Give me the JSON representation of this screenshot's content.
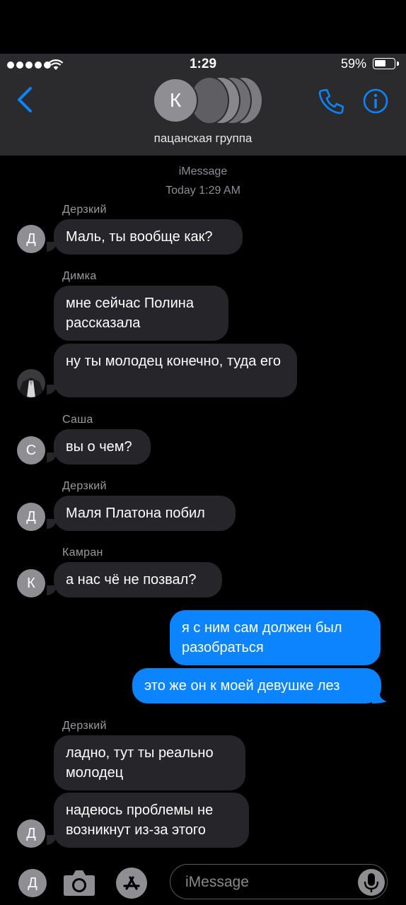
{
  "status_bar": {
    "time": "1:29",
    "battery": "59%",
    "battery_level": 0.59
  },
  "header": {
    "group_initial": "К",
    "group_name": "пацанская группа"
  },
  "thread": {
    "service": "iMessage",
    "timestamp": "Today 1:29 AM"
  },
  "messages": [
    {
      "sender": "Дерзкий",
      "initial": "Д",
      "text": "Маль, ты вообще как?"
    },
    {
      "sender": "Димка",
      "text": "мне сейчас Полина рассказала"
    },
    {
      "text": "ну ты молодец конечно, туда его"
    },
    {
      "sender": "Саша",
      "initial": "С",
      "text": "вы о чем?"
    },
    {
      "sender": "Дерзкий",
      "initial": "Д",
      "text": "Маля Платона побил"
    },
    {
      "sender": "Камран",
      "initial": "К",
      "text": "а нас чё не позвал?"
    },
    {
      "out": true,
      "text": "я с ним сам должен был разобраться"
    },
    {
      "out": true,
      "text": "это же он к моей девушке лез"
    },
    {
      "sender": "Дерзкий",
      "text": "ладно, тут ты реально молодец"
    },
    {
      "initial": "Д",
      "text": "надеюсь проблемы не возникнут из-за этого"
    }
  ],
  "composer": {
    "left_initial": "Д",
    "placeholder": "iMessage"
  },
  "colors": {
    "accent": "#0b84fe",
    "incoming": "#26252a",
    "header_bg": "#2b2b2d"
  },
  "icons": [
    "back-chevron-icon",
    "phone-icon",
    "info-icon",
    "camera-icon",
    "app-store-icon",
    "microphone-icon",
    "wifi-icon"
  ]
}
